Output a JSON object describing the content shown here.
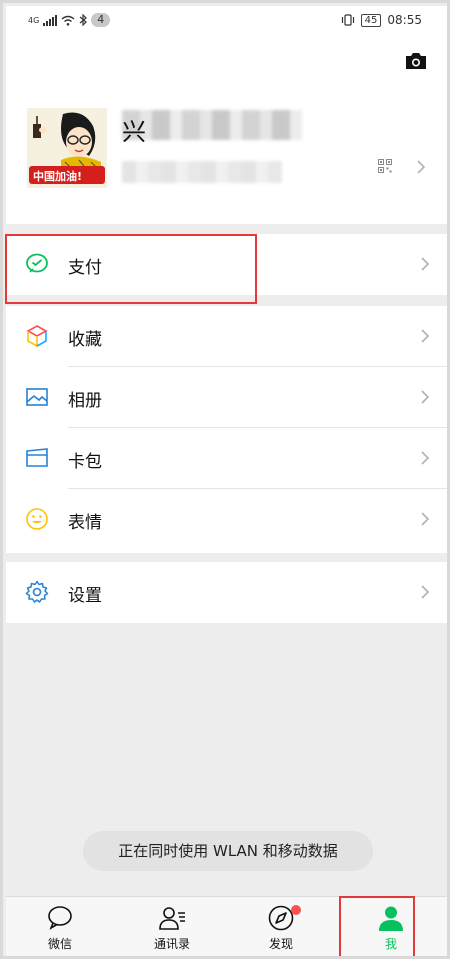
{
  "status_bar": {
    "network": "4G",
    "notification_count": "4",
    "battery": "45",
    "time": "08:55"
  },
  "profile": {
    "nickname_visible": "兴",
    "avatar_text": "中国加油!"
  },
  "menu": {
    "pay": "支付",
    "favorites": "收藏",
    "album": "相册",
    "cards": "卡包",
    "stickers": "表情",
    "settings": "设置"
  },
  "toast": "正在同时使用 WLAN 和移动数据",
  "tabs": [
    {
      "label": "微信",
      "icon": "chat-bubble-icon"
    },
    {
      "label": "通讯录",
      "icon": "contacts-icon"
    },
    {
      "label": "发现",
      "icon": "compass-icon"
    },
    {
      "label": "我",
      "icon": "person-icon"
    }
  ],
  "colors": {
    "accent": "#07c160",
    "highlight_box": "#e03a3a",
    "badge_dot": "#fa5151"
  }
}
